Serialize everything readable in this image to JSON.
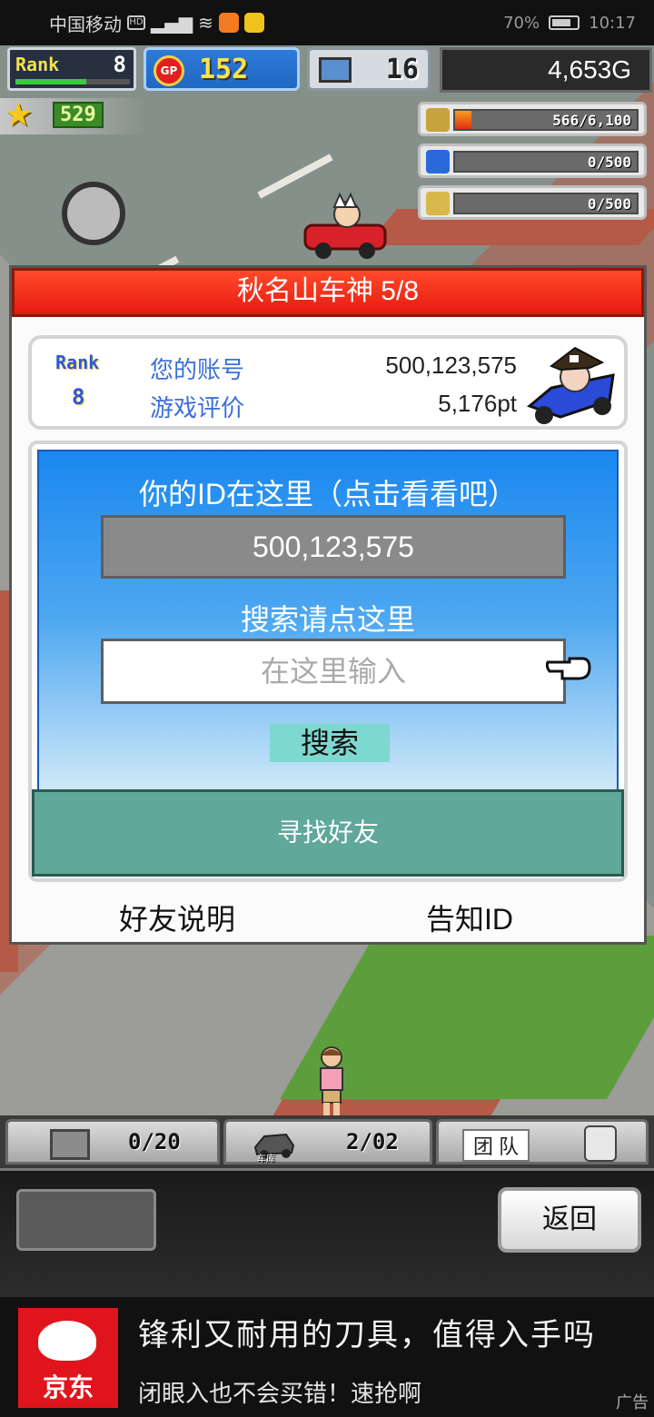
{
  "status_bar": {
    "carrier": "中国移动",
    "battery": "70%",
    "time": "10:17"
  },
  "hud": {
    "rank_label": "Rank",
    "rank_value": "8",
    "gp_coin": "GP",
    "gp_value": "152",
    "pc_value": "16",
    "money": "4,653G",
    "star_value": "529"
  },
  "resources": [
    {
      "icon": "coins-icon",
      "text": "566/6,100",
      "fill": 0.09
    },
    {
      "icon": "fuel-icon",
      "text": "0/500",
      "fill": 0
    },
    {
      "icon": "wheat-icon",
      "text": "0/500",
      "fill": 0
    }
  ],
  "dialog": {
    "title": "秋名山车神 5/8",
    "profile": {
      "rank_label": "Rank",
      "rank_value": "8",
      "account_label": "您的账号",
      "account_value": "500,123,575",
      "rating_label": "游戏评价",
      "rating_value": "5,176pt"
    },
    "id_heading": "你的ID在这里（点击看看吧）",
    "id_value": "500,123,575",
    "search_heading": "搜索请点这里",
    "search_placeholder": "在这里输入",
    "search_button": "搜索",
    "find_friends": "寻找好友",
    "friend_help": "好友说明",
    "share_id": "告知ID"
  },
  "bottom_tabs": {
    "crate_count": "0/20",
    "garage_label": "车库",
    "garage_count": "2/02",
    "team_label": "团 队"
  },
  "bottom_panel": {
    "back_button": "返回"
  },
  "ad": {
    "brand": "京东",
    "title": "锋利又耐用的刀具，值得入手吗",
    "subtitle": "闭眼入也不会买错！速抢啊",
    "tag": "广告"
  },
  "colors": {
    "dialog_title_bg": "#e81a10",
    "id_panel_top": "#1a88f0",
    "find_friends_bg": "#5fa89a",
    "search_button_bg": "#7dd8d0"
  }
}
